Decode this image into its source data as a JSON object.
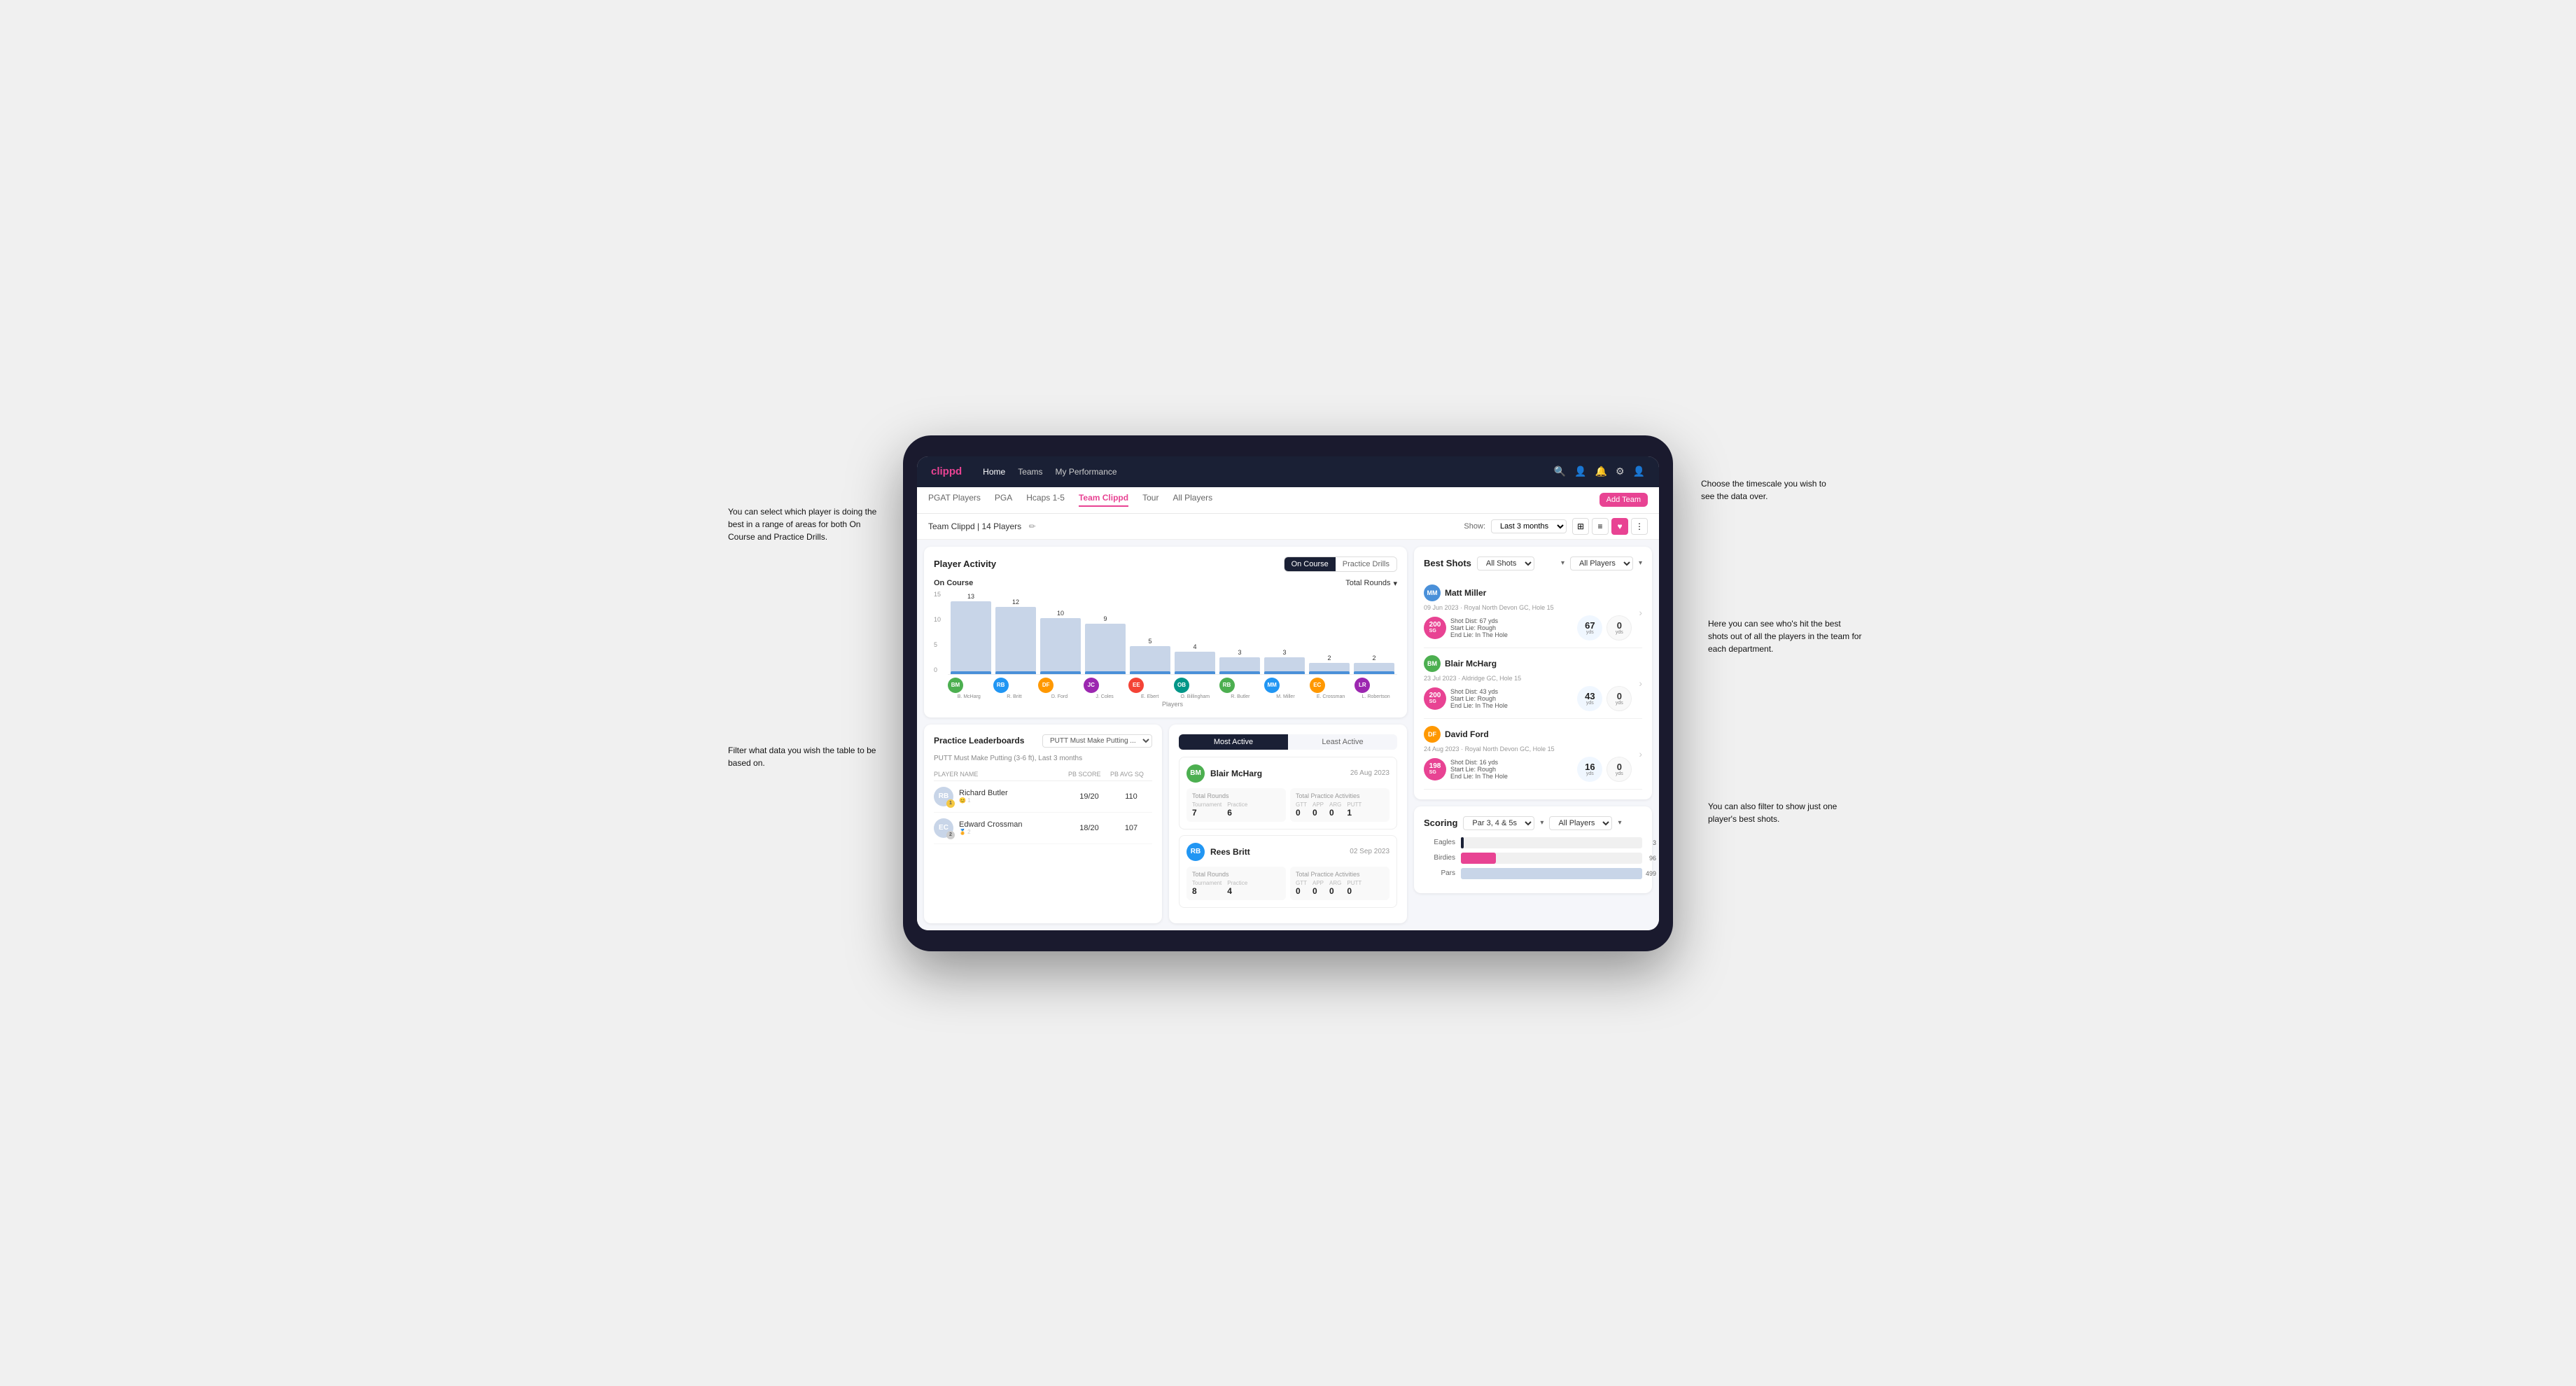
{
  "app": {
    "logo": "clippd",
    "nav": {
      "links": [
        "Home",
        "Teams",
        "My Performance"
      ],
      "active": "Teams",
      "icons": [
        "search",
        "person",
        "bell",
        "settings",
        "profile"
      ]
    },
    "sub_nav": {
      "tabs": [
        "PGAT Players",
        "PGA",
        "Hcaps 1-5",
        "Team Clippd",
        "Tour",
        "All Players"
      ],
      "active": "Team Clippd",
      "add_button": "Add Team"
    }
  },
  "team_header": {
    "title": "Team Clippd | 14 Players",
    "show_label": "Show:",
    "time_filter": "Last 3 months",
    "view_modes": [
      "grid",
      "list",
      "heart",
      "filter"
    ]
  },
  "player_activity": {
    "title": "Player Activity",
    "toggle": {
      "options": [
        "On Course",
        "Practice Drills"
      ],
      "active": "On Course"
    },
    "chart": {
      "on_course_label": "On Course",
      "dropdown_label": "Total Rounds",
      "y_axis": [
        "15",
        "10",
        "5",
        "0"
      ],
      "players_label": "Players",
      "bars": [
        {
          "name": "B. McHarg",
          "value": 13,
          "height": 104
        },
        {
          "name": "R. Britt",
          "value": 12,
          "height": 96
        },
        {
          "name": "D. Ford",
          "value": 10,
          "height": 80
        },
        {
          "name": "J. Coles",
          "value": 9,
          "height": 72
        },
        {
          "name": "E. Ebert",
          "value": 5,
          "height": 40
        },
        {
          "name": "O. Billingham",
          "value": 4,
          "height": 32
        },
        {
          "name": "R. Butler",
          "value": 3,
          "height": 24
        },
        {
          "name": "M. Miller",
          "value": 3,
          "height": 24
        },
        {
          "name": "E. Crossman",
          "value": 2,
          "height": 16
        },
        {
          "name": "L. Robertson",
          "value": 2,
          "height": 16
        }
      ]
    }
  },
  "practice_leaderboards": {
    "title": "Practice Leaderboards",
    "dropdown": "PUTT Must Make Putting ...",
    "subtitle": "PUTT Must Make Putting (3-6 ft), Last 3 months",
    "columns": [
      "PLAYER NAME",
      "PB SCORE",
      "PB AVG SQ"
    ],
    "rows": [
      {
        "rank": 1,
        "rank_badge": "1",
        "name": "Richard Butler",
        "score": "19/20",
        "avg": "110"
      },
      {
        "rank": 2,
        "rank_badge": "2",
        "name": "Edward Crossman",
        "score": "18/20",
        "avg": "107"
      }
    ]
  },
  "most_active": {
    "toggle": {
      "options": [
        "Most Active",
        "Least Active"
      ],
      "active": "Most Active"
    },
    "players": [
      {
        "name": "Blair McHarg",
        "date": "26 Aug 2023",
        "avatar_color": "green",
        "total_rounds_label": "Total Rounds",
        "tournament": "7",
        "practice": "6",
        "total_practice_label": "Total Practice Activities",
        "gtt": "0",
        "app": "0",
        "arg": "0",
        "putt": "1"
      },
      {
        "name": "Rees Britt",
        "date": "02 Sep 2023",
        "avatar_color": "blue",
        "total_rounds_label": "Total Rounds",
        "tournament": "8",
        "practice": "4",
        "total_practice_label": "Total Practice Activities",
        "gtt": "0",
        "app": "0",
        "arg": "0",
        "putt": "0"
      }
    ]
  },
  "best_shots": {
    "title": "Best Shots",
    "filter1": "All Shots",
    "filter2": "All Players",
    "players": [
      {
        "name": "Matt Miller",
        "date": "09 Jun 2023",
        "course": "Royal North Devon GC",
        "hole": "Hole 15",
        "badge_text": "200",
        "badge_sub": "SG",
        "shot_dist": "Shot Dist: 67 yds",
        "start_lie": "Start Lie: Rough",
        "end_lie": "End Lie: In The Hole",
        "metric1_value": "67",
        "metric1_unit": "yds",
        "metric2_value": "0",
        "metric2_unit": "yds"
      },
      {
        "name": "Blair McHarg",
        "date": "23 Jul 2023",
        "course": "Aldridge GC",
        "hole": "Hole 15",
        "badge_text": "200",
        "badge_sub": "SG",
        "shot_dist": "Shot Dist: 43 yds",
        "start_lie": "Start Lie: Rough",
        "end_lie": "End Lie: In The Hole",
        "metric1_value": "43",
        "metric1_unit": "yds",
        "metric2_value": "0",
        "metric2_unit": "yds"
      },
      {
        "name": "David Ford",
        "date": "24 Aug 2023",
        "course": "Royal North Devon GC",
        "hole": "Hole 15",
        "badge_text": "198",
        "badge_sub": "SG",
        "shot_dist": "Shot Dist: 16 yds",
        "start_lie": "Start Lie: Rough",
        "end_lie": "End Lie: In The Hole",
        "metric1_value": "16",
        "metric1_unit": "yds",
        "metric2_value": "0",
        "metric2_unit": "yds"
      }
    ]
  },
  "scoring": {
    "title": "Scoring",
    "filter1": "Par 3, 4 & 5s",
    "filter2": "All Players",
    "bars": [
      {
        "label": "Eagles",
        "value": 3,
        "max": 499,
        "type": "eagles"
      },
      {
        "label": "Birdies",
        "value": 96,
        "max": 499,
        "type": "birdies"
      },
      {
        "label": "Pars",
        "value": 499,
        "max": 499,
        "type": "pars"
      }
    ]
  },
  "annotations": {
    "top_right": "Choose the timescale you wish to see the data over.",
    "left_1": "You can select which player is doing the best in a range of areas for both On Course and Practice Drills.",
    "left_2": "Filter what data you wish the table to be based on.",
    "right_1": "Here you can see who's hit the best shots out of all the players in the team for each department.",
    "right_2": "You can also filter to show just one player's best shots."
  }
}
